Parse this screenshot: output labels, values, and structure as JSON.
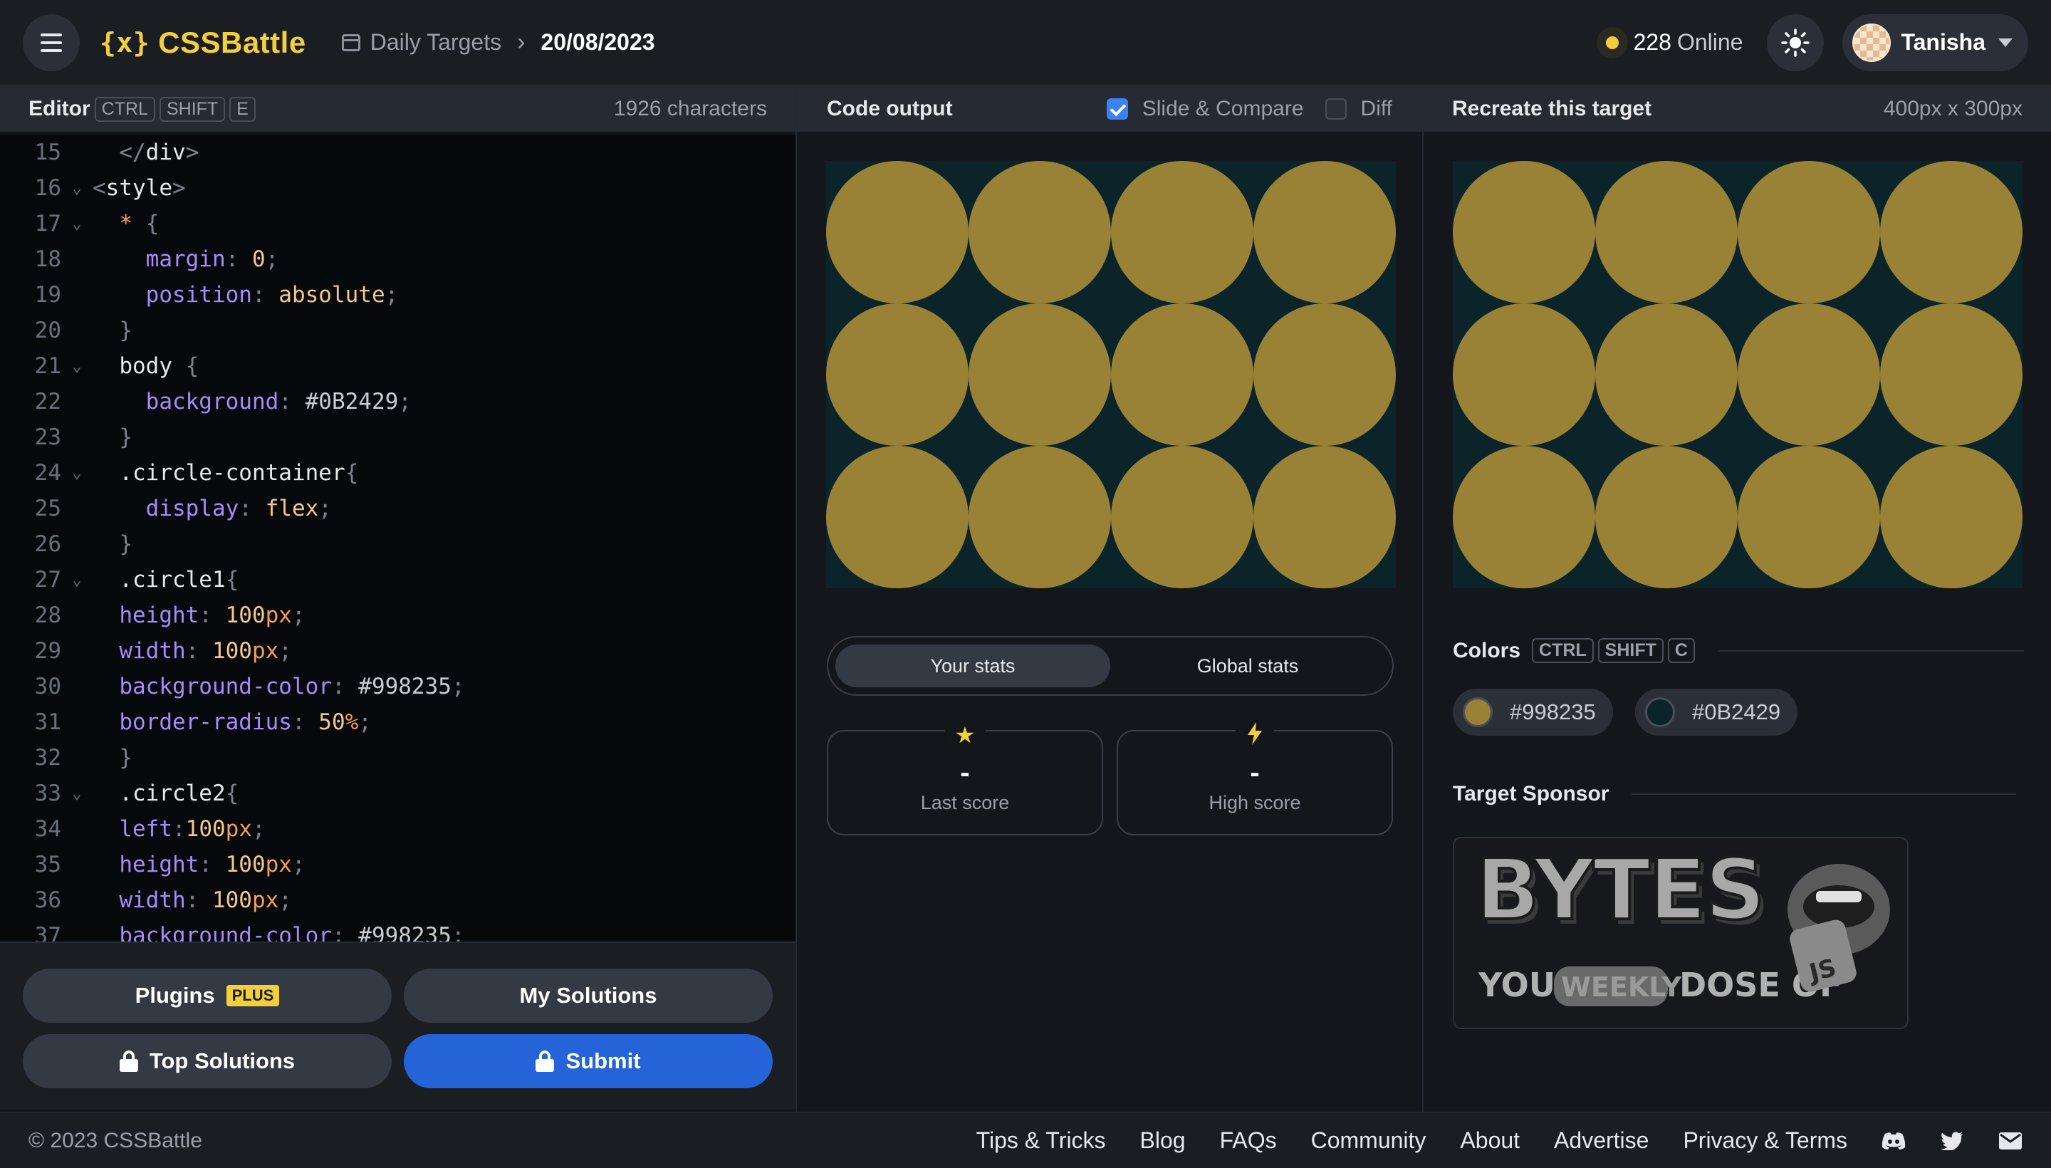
{
  "header": {
    "logo_mark": "{x}",
    "logo_text": "CSSBattle",
    "breadcrumb_link": "Daily Targets",
    "breadcrumb_sep": "›",
    "breadcrumb_current": "20/08/2023",
    "online_count": "228",
    "online_label": "Online",
    "user_name": "Tanisha"
  },
  "editor": {
    "title": "Editor",
    "shortcut": [
      "CTRL",
      "SHIFT",
      "E"
    ],
    "char_count": "1926 characters",
    "lines": [
      {
        "n": "15",
        "fold": false,
        "code": [
          [
            "tok-punc",
            "  </"
          ],
          [
            "tok-tag",
            "div"
          ],
          [
            "tok-punc",
            ">"
          ]
        ]
      },
      {
        "n": "16",
        "fold": true,
        "code": [
          [
            "tok-punc",
            "<"
          ],
          [
            "tok-tag",
            "style"
          ],
          [
            "tok-punc",
            ">"
          ]
        ]
      },
      {
        "n": "17",
        "fold": true,
        "code": [
          [
            "tok-star",
            "  * "
          ],
          [
            "tok-punc",
            "{"
          ]
        ]
      },
      {
        "n": "18",
        "fold": false,
        "code": [
          [
            "tok-prop",
            "    margin"
          ],
          [
            "tok-punc",
            ": "
          ],
          [
            "tok-num",
            "0"
          ],
          [
            "tok-punc",
            ";"
          ]
        ]
      },
      {
        "n": "19",
        "fold": false,
        "code": [
          [
            "tok-prop",
            "    position"
          ],
          [
            "tok-punc",
            ": "
          ],
          [
            "tok-val",
            "absolute"
          ],
          [
            "tok-punc",
            ";"
          ]
        ]
      },
      {
        "n": "20",
        "fold": false,
        "code": [
          [
            "tok-punc",
            "  }"
          ]
        ]
      },
      {
        "n": "21",
        "fold": true,
        "code": [
          [
            "tok-sel",
            "  body "
          ],
          [
            "tok-punc",
            "{"
          ]
        ]
      },
      {
        "n": "22",
        "fold": false,
        "code": [
          [
            "tok-prop",
            "    background"
          ],
          [
            "tok-punc",
            ": "
          ],
          [
            "tok-hex",
            "#0B2429"
          ],
          [
            "tok-punc",
            ";"
          ]
        ]
      },
      {
        "n": "23",
        "fold": false,
        "code": [
          [
            "tok-punc",
            "  }"
          ]
        ]
      },
      {
        "n": "24",
        "fold": true,
        "code": [
          [
            "tok-sel",
            "  .circle-container"
          ],
          [
            "tok-punc",
            "{"
          ]
        ]
      },
      {
        "n": "25",
        "fold": false,
        "code": [
          [
            "tok-prop",
            "    display"
          ],
          [
            "tok-punc",
            ": "
          ],
          [
            "tok-val",
            "flex"
          ],
          [
            "tok-punc",
            ";"
          ]
        ]
      },
      {
        "n": "26",
        "fold": false,
        "code": [
          [
            "tok-punc",
            "  }"
          ]
        ]
      },
      {
        "n": "27",
        "fold": true,
        "code": [
          [
            "tok-sel",
            "  .circle1"
          ],
          [
            "tok-punc",
            "{"
          ]
        ]
      },
      {
        "n": "28",
        "fold": false,
        "code": [
          [
            "tok-prop",
            "  height"
          ],
          [
            "tok-punc",
            ": "
          ],
          [
            "tok-num",
            "100"
          ],
          [
            "tok-unit",
            "px"
          ],
          [
            "tok-punc",
            ";"
          ]
        ]
      },
      {
        "n": "29",
        "fold": false,
        "code": [
          [
            "tok-prop",
            "  width"
          ],
          [
            "tok-punc",
            ": "
          ],
          [
            "tok-num",
            "100"
          ],
          [
            "tok-unit",
            "px"
          ],
          [
            "tok-punc",
            ";"
          ]
        ]
      },
      {
        "n": "30",
        "fold": false,
        "code": [
          [
            "tok-prop",
            "  background-color"
          ],
          [
            "tok-punc",
            ": "
          ],
          [
            "tok-hex",
            "#998235"
          ],
          [
            "tok-punc",
            ";"
          ]
        ]
      },
      {
        "n": "31",
        "fold": false,
        "code": [
          [
            "tok-prop",
            "  border-radius"
          ],
          [
            "tok-punc",
            ": "
          ],
          [
            "tok-num",
            "50"
          ],
          [
            "tok-unit",
            "%"
          ],
          [
            "tok-punc",
            ";"
          ]
        ]
      },
      {
        "n": "32",
        "fold": false,
        "code": [
          [
            "tok-punc",
            "  }"
          ]
        ]
      },
      {
        "n": "33",
        "fold": true,
        "code": [
          [
            "tok-sel",
            "  .circle2"
          ],
          [
            "tok-punc",
            "{"
          ]
        ]
      },
      {
        "n": "34",
        "fold": false,
        "code": [
          [
            "tok-prop",
            "  left"
          ],
          [
            "tok-punc",
            ":"
          ],
          [
            "tok-num",
            "100"
          ],
          [
            "tok-unit",
            "px"
          ],
          [
            "tok-punc",
            ";"
          ]
        ]
      },
      {
        "n": "35",
        "fold": false,
        "code": [
          [
            "tok-prop",
            "  height"
          ],
          [
            "tok-punc",
            ": "
          ],
          [
            "tok-num",
            "100"
          ],
          [
            "tok-unit",
            "px"
          ],
          [
            "tok-punc",
            ";"
          ]
        ]
      },
      {
        "n": "36",
        "fold": false,
        "code": [
          [
            "tok-prop",
            "  width"
          ],
          [
            "tok-punc",
            ": "
          ],
          [
            "tok-num",
            "100"
          ],
          [
            "tok-unit",
            "px"
          ],
          [
            "tok-punc",
            ";"
          ]
        ]
      },
      {
        "n": "37",
        "fold": false,
        "code": [
          [
            "tok-prop",
            "  background-color"
          ],
          [
            "tok-punc",
            ": "
          ],
          [
            "tok-hex",
            "#998235"
          ],
          [
            "tok-punc",
            ";"
          ]
        ]
      }
    ],
    "buttons": {
      "plugins": "Plugins",
      "plugins_badge": "PLUS",
      "my_solutions": "My Solutions",
      "top_solutions": "Top Solutions",
      "submit": "Submit"
    }
  },
  "output": {
    "title": "Code output",
    "slide_compare": "Slide & Compare",
    "slide_compare_checked": true,
    "diff": "Diff",
    "diff_checked": false,
    "stats_tabs": [
      "Your stats",
      "Global stats"
    ],
    "active_tab": 0,
    "last_score_value": "-",
    "last_score_label": "Last score",
    "high_score_value": "-",
    "high_score_label": "High score"
  },
  "target": {
    "title": "Recreate this target",
    "size": "400px x 300px",
    "colors_title": "Colors",
    "colors_shortcut": [
      "CTRL",
      "SHIFT",
      "C"
    ],
    "colors": [
      "#998235",
      "#0B2429"
    ],
    "sponsor_title": "Target Sponsor",
    "sponsor_logo_word": "BYTES",
    "sponsor_tagline_1": "YOUR",
    "sponsor_tagline_2": "WEEKLY",
    "sponsor_tagline_3": "DOSE OF",
    "sponsor_badge": "JS"
  },
  "footer": {
    "copyright": "© 2023 CSSBattle",
    "links": [
      "Tips & Tricks",
      "Blog",
      "FAQs",
      "Community",
      "About",
      "Advertise",
      "Privacy & Terms"
    ]
  },
  "theme": {
    "accent": "#f4cf3c",
    "primary_button": "#2563d9",
    "circle_color": "#998235",
    "canvas_bg": "#0B2429"
  },
  "icons": [
    "menu-icon",
    "calendar-icon",
    "sun-icon",
    "lock-icon",
    "star-icon",
    "bolt-icon",
    "discord-icon",
    "twitter-icon",
    "mail-icon"
  ]
}
